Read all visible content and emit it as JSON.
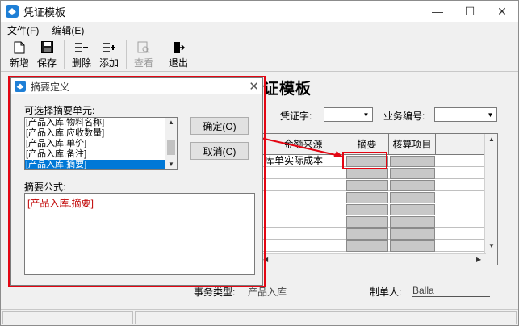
{
  "window": {
    "title": "凭证模板",
    "buttons": {
      "minimize": "—",
      "maximize": "☐",
      "close": "✕"
    }
  },
  "menu": [
    "文件(F)",
    "编辑(E)"
  ],
  "toolbar": {
    "new_label": "新增",
    "save_label": "保存",
    "delete_label": "删除",
    "add_label": "添加",
    "view_label": "查看",
    "exit_label": "退出"
  },
  "form": {
    "title": "证模板",
    "voucher_word_label": "凭证字:",
    "business_no_label": "业务编号:",
    "grid": {
      "headers": [
        "金额来源",
        "摘要",
        "核算项目"
      ],
      "first_row_source": "库单实际成本"
    },
    "business_type_label": "事务类型:",
    "business_type_value": "产品入库",
    "creator_label": "制单人:",
    "creator_value": "Balla"
  },
  "dialog": {
    "title": "摘要定义",
    "units_label": "可选择摘要单元:",
    "units": [
      "[产品入库.物料名称]",
      "[产品入库.应收数量]",
      "[产品入库.单价]",
      "[产品入库.备注]",
      "[产品入库.摘要]"
    ],
    "selected_index": 4,
    "ok_label": "确定(O)",
    "cancel_label": "取消(C)",
    "formula_label": "摘要公式:",
    "formula_value": "[产品入库.摘要]"
  },
  "colors": {
    "highlight": "#e30613",
    "selection": "#0078d7",
    "formula_text": "#c00000"
  },
  "icons": [
    "app-icon",
    "new-doc-icon",
    "save-disk-icon",
    "delete-row-icon",
    "add-row-icon",
    "view-icon",
    "exit-door-icon"
  ]
}
